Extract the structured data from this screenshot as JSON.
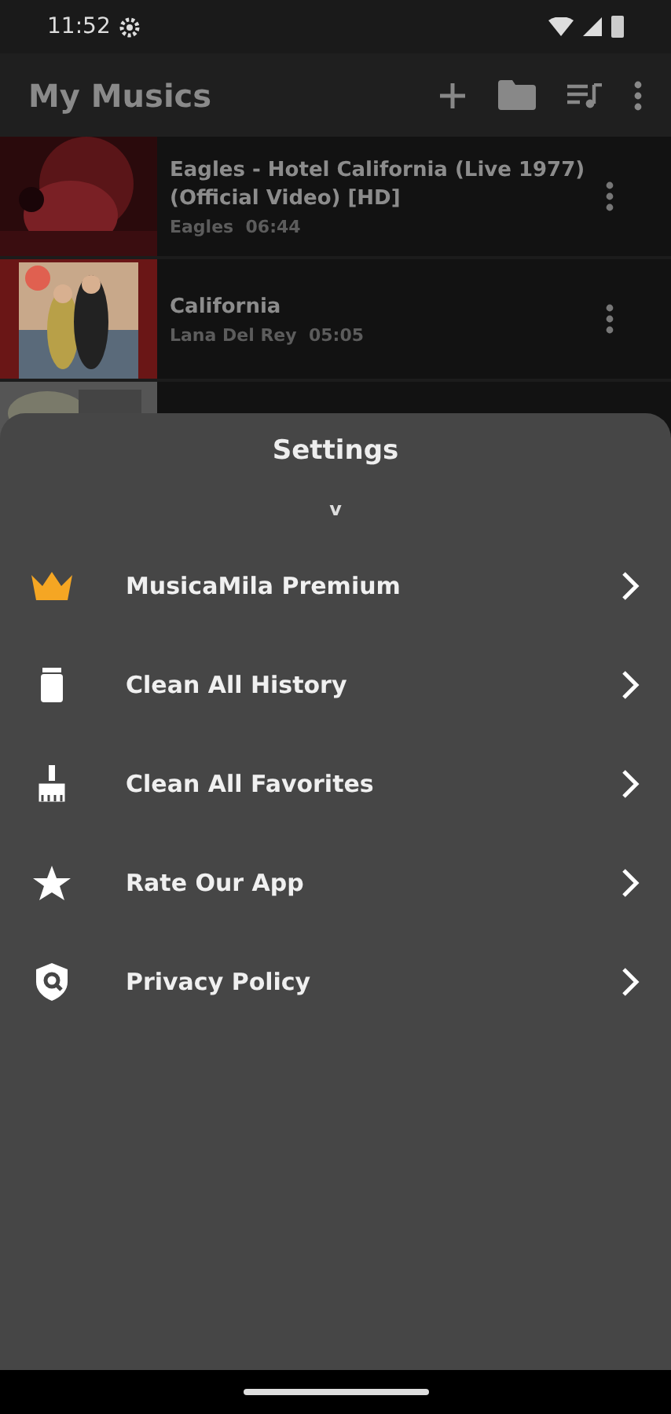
{
  "status_bar": {
    "time": "11:52"
  },
  "app_bar": {
    "title": "My Musics"
  },
  "tracks": [
    {
      "title": "Eagles - Hotel California (Live 1977) (Official Video) [HD]",
      "artist": "Eagles",
      "duration": "06:44",
      "kind": "song"
    },
    {
      "title": "California",
      "artist": "Lana Del Rey",
      "duration": "05:05",
      "kind": "song"
    },
    {
      "kind": "covered"
    }
  ],
  "sheet": {
    "title": "Settings",
    "handle": "v",
    "items": [
      {
        "kind": "crown",
        "label": "MusicaMila Premium"
      },
      {
        "kind": "trash",
        "label": "Clean All History"
      },
      {
        "kind": "broom",
        "label": "Clean All Favorites"
      },
      {
        "kind": "star",
        "label": "Rate Our App"
      },
      {
        "kind": "shield",
        "label": "Privacy Policy"
      }
    ]
  }
}
